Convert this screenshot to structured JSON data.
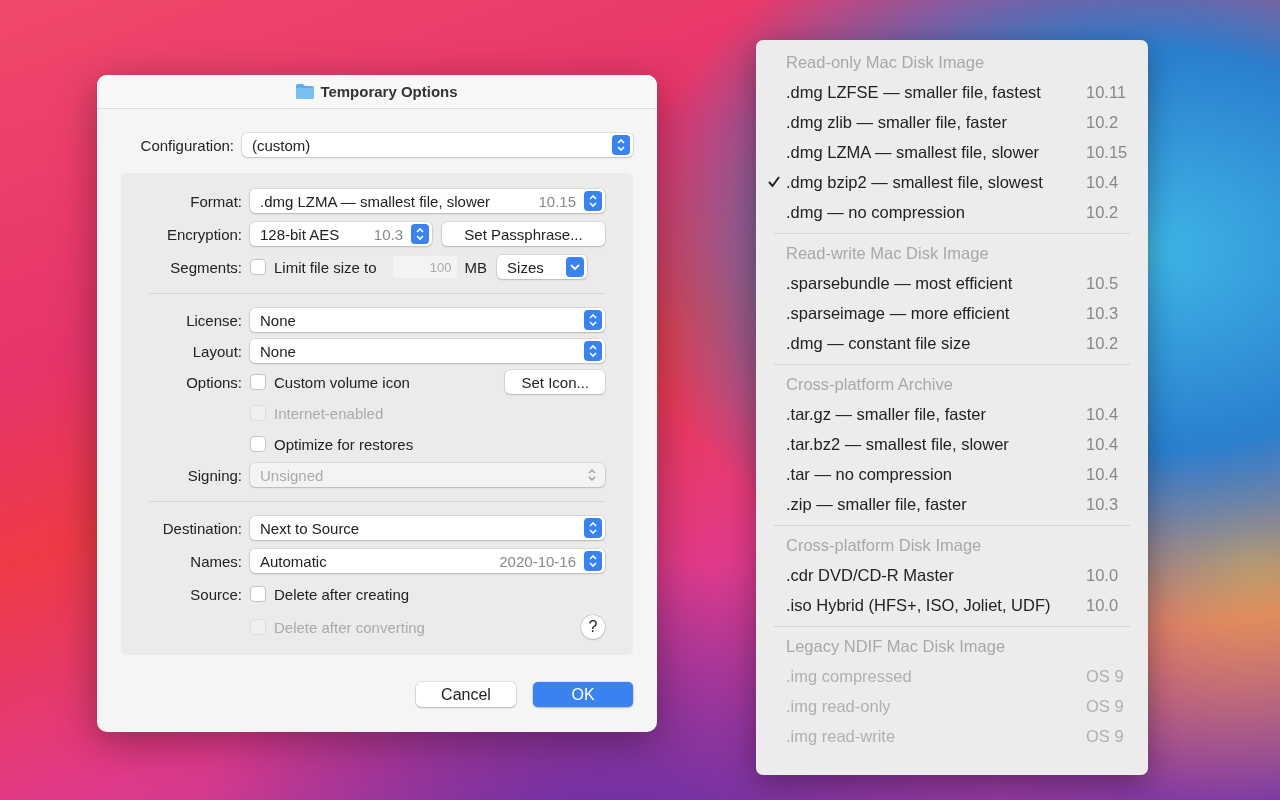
{
  "dialog": {
    "title": "Temporary Options",
    "configuration": {
      "label": "Configuration:",
      "value": "(custom)"
    },
    "groups": [
      {
        "rows": [
          {
            "label": "Format:",
            "controls": [
              {
                "kind": "popup",
                "value": ".dmg LZMA — smallest file, slower",
                "detail": "10.15",
                "disabled": false
              }
            ]
          },
          {
            "label": "Encryption:",
            "controls": [
              {
                "kind": "popup",
                "value": "128-bit AES",
                "detail": "10.3",
                "disabled": false
              },
              {
                "kind": "button",
                "label": "Set Passphrase..."
              }
            ]
          },
          {
            "label": "Segments:",
            "controls": [
              {
                "kind": "checkbox",
                "label": "Limit file size to",
                "checked": false,
                "disabled": false
              },
              {
                "kind": "field",
                "placeholder": "100"
              },
              {
                "kind": "text",
                "text": "MB"
              },
              {
                "kind": "pulldown",
                "value": "Sizes"
              }
            ]
          }
        ]
      },
      {
        "rows": [
          {
            "label": "License:",
            "controls": [
              {
                "kind": "popup",
                "value": "None",
                "disabled": false
              }
            ]
          },
          {
            "label": "Layout:",
            "controls": [
              {
                "kind": "popup",
                "value": "None",
                "disabled": false
              }
            ]
          },
          {
            "label": "Options:",
            "controls": [
              {
                "kind": "checkbox",
                "label": "Custom volume icon",
                "checked": false,
                "disabled": false
              },
              {
                "kind": "button",
                "label": "Set Icon..."
              }
            ]
          },
          {
            "controls": [
              {
                "kind": "checkbox",
                "label": "Internet-enabled",
                "checked": false,
                "disabled": true
              }
            ]
          },
          {
            "controls": [
              {
                "kind": "checkbox",
                "label": "Optimize for restores",
                "checked": false,
                "disabled": false
              }
            ]
          },
          {
            "label": "Signing:",
            "controls": [
              {
                "kind": "popup",
                "value": "Unsigned",
                "disabled": true
              }
            ]
          }
        ]
      },
      {
        "rows": [
          {
            "label": "Destination:",
            "controls": [
              {
                "kind": "popup",
                "value": "Next to Source",
                "disabled": false
              }
            ]
          },
          {
            "label": "Names:",
            "controls": [
              {
                "kind": "popup",
                "value": "Automatic",
                "detail": "2020-10-16",
                "disabled": false
              }
            ]
          },
          {
            "label": "Source:",
            "controls": [
              {
                "kind": "checkbox",
                "label": "Delete after creating",
                "checked": false,
                "disabled": false
              }
            ]
          },
          {
            "controls": [
              {
                "kind": "checkbox",
                "label": "Delete after converting",
                "checked": false,
                "disabled": true
              },
              {
                "kind": "help",
                "text": "?"
              }
            ]
          }
        ]
      }
    ],
    "buttons": [
      {
        "label": "Cancel",
        "default": false
      },
      {
        "label": "OK",
        "default": true
      }
    ]
  },
  "menu": {
    "sections": [
      {
        "header": "Read-only Mac Disk Image",
        "items": [
          {
            "label": ".dmg LZFSE — smaller file, fastest",
            "version": "10.11",
            "checked": false,
            "disabled": false
          },
          {
            "label": ".dmg zlib — smaller file, faster",
            "version": "10.2",
            "checked": false,
            "disabled": false
          },
          {
            "label": ".dmg LZMA — smallest file, slower",
            "version": "10.15",
            "checked": false,
            "disabled": false
          },
          {
            "label": ".dmg bzip2 — smallest file, slowest",
            "version": "10.4",
            "checked": true,
            "disabled": false
          },
          {
            "label": ".dmg — no compression",
            "version": "10.2",
            "checked": false,
            "disabled": false
          }
        ]
      },
      {
        "header": "Read-write Mac Disk Image",
        "items": [
          {
            "label": ".sparsebundle — most efficient",
            "version": "10.5",
            "checked": false,
            "disabled": false
          },
          {
            "label": ".sparseimage — more efficient",
            "version": "10.3",
            "checked": false,
            "disabled": false
          },
          {
            "label": ".dmg — constant file size",
            "version": "10.2",
            "checked": false,
            "disabled": false
          }
        ]
      },
      {
        "header": "Cross-platform Archive",
        "items": [
          {
            "label": ".tar.gz — smaller file, faster",
            "version": "10.4",
            "checked": false,
            "disabled": false
          },
          {
            "label": ".tar.bz2 — smallest file, slower",
            "version": "10.4",
            "checked": false,
            "disabled": false
          },
          {
            "label": ".tar — no compression",
            "version": "10.4",
            "checked": false,
            "disabled": false
          },
          {
            "label": ".zip — smaller file, faster",
            "version": "10.3",
            "checked": false,
            "disabled": false
          }
        ]
      },
      {
        "header": "Cross-platform Disk Image",
        "items": [
          {
            "label": ".cdr DVD/CD-R Master",
            "version": "10.0",
            "checked": false,
            "disabled": false
          },
          {
            "label": ".iso Hybrid (HFS+, ISO, Joliet, UDF)",
            "version": "10.0",
            "checked": false,
            "disabled": false
          }
        ]
      },
      {
        "header": "Legacy NDIF Mac Disk Image",
        "items": [
          {
            "label": ".img compressed",
            "version": "OS 9",
            "checked": false,
            "disabled": true
          },
          {
            "label": ".img read-only",
            "version": "OS 9",
            "checked": false,
            "disabled": true
          },
          {
            "label": ".img read-write",
            "version": "OS 9",
            "checked": false,
            "disabled": true
          }
        ]
      }
    ]
  }
}
